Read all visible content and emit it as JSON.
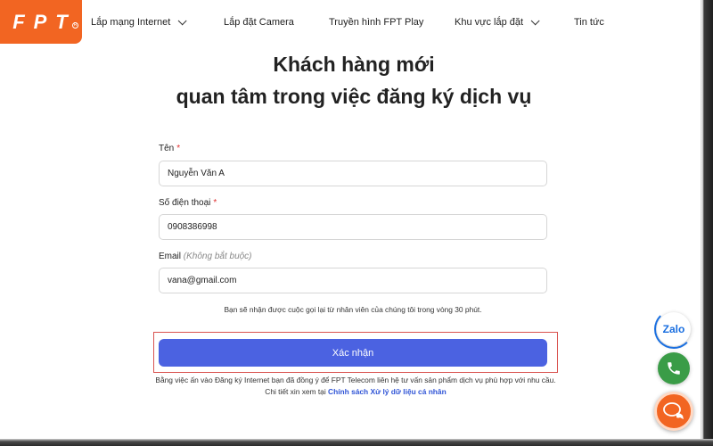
{
  "logo": {
    "text": [
      "F",
      "P",
      "T"
    ],
    "brand_color": "#f26522"
  },
  "nav": {
    "items": [
      {
        "label": "Lắp mạng Internet",
        "has_dropdown": true
      },
      {
        "label": "Lắp đặt Camera",
        "has_dropdown": false
      },
      {
        "label": "Truyền hình FPT Play",
        "has_dropdown": false
      },
      {
        "label": "Khu vực lắp đặt",
        "has_dropdown": true
      },
      {
        "label": "Tin tức",
        "has_dropdown": false
      }
    ]
  },
  "heading": {
    "line1": "Khách hàng mới",
    "line2": "quan tâm trong việc đăng ký dịch vụ"
  },
  "form": {
    "name_label": "Tên",
    "name_required": "*",
    "name_value": "Nguyễn Văn A",
    "phone_label": "Số điện thoại",
    "phone_required": "*",
    "phone_value": "0908386998",
    "email_label": "Email",
    "email_optional": "(Không bắt buộc)",
    "email_value": "vana@gmail.com",
    "callback_note": "Bạn sẽ nhận được cuộc gọi lại từ nhân viên của chúng tôi trong vòng 30 phút.",
    "submit_label": "Xác nhận",
    "consent_text": "Bằng việc ấn vào Đăng ký Internet bạn đã đồng ý để FPT Telecom liên hệ tư vấn sản phẩm dịch vụ phù hợp với nhu cầu. Chi tiết xin xem tại",
    "consent_link": "Chính sách Xử lý dữ liệu cá nhân"
  },
  "widgets": {
    "zalo_label": "Zalo",
    "phone_icon": "phone-icon",
    "chat_icon": "chat-bubbles-icon"
  },
  "colors": {
    "accent": "#4b62e1",
    "required": "#e03131",
    "highlight_border": "#d9534f",
    "phone_green": "#3a9c47",
    "link": "#2f54d6"
  }
}
